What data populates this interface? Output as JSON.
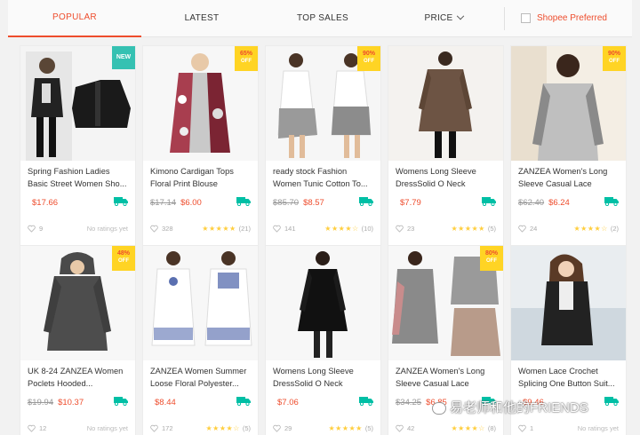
{
  "sortbar": {
    "tabs": [
      "POPULAR",
      "LATEST",
      "TOP SALES",
      "PRICE"
    ],
    "active": "POPULAR",
    "preferred_label": "Shopee Preferred"
  },
  "products": [
    {
      "name": "Spring Fashion Ladies Basic Street Women Sho...",
      "old_price": "",
      "price": "$17.66",
      "likes": "9",
      "rating_count": "",
      "no_rating_text": "No ratings yet",
      "badge": "NEW",
      "stars": 0
    },
    {
      "name": "Kimono Cardigan Tops Floral Print Blouse",
      "old_price": "$17.14",
      "price": "$6.00",
      "likes": "328",
      "rating_count": "(21)",
      "no_rating_text": "",
      "badge_pct": "65%",
      "badge_off": "OFF",
      "stars": 5
    },
    {
      "name": "ready stock Fashion Women Tunic Cotton To...",
      "old_price": "$85.70",
      "price": "$8.57",
      "likes": "141",
      "rating_count": "(10)",
      "no_rating_text": "",
      "badge_pct": "90%",
      "badge_off": "OFF",
      "stars": 4
    },
    {
      "name": "Womens Long Sleeve DressSolid O Neck Casua...",
      "old_price": "",
      "price": "$7.79",
      "likes": "23",
      "rating_count": "(5)",
      "no_rating_text": "",
      "stars": 5
    },
    {
      "name": "ZANZEA Women's Long Sleeve Casual Lace Loos...",
      "old_price": "$62.40",
      "price": "$6.24",
      "likes": "24",
      "rating_count": "(2)",
      "no_rating_text": "",
      "badge_pct": "90%",
      "badge_off": "OFF",
      "stars": 4
    },
    {
      "name": "UK 8-24 ZANZEA Women Poclets Hooded...",
      "old_price": "$19.94",
      "price": "$10.37",
      "likes": "12",
      "rating_count": "",
      "no_rating_text": "No ratings yet",
      "badge_pct": "48%",
      "badge_off": "OFF",
      "stars": 0
    },
    {
      "name": "ZANZEA Women Summer Loose Floral Polyester...",
      "old_price": "",
      "price": "$8.44",
      "likes": "172",
      "rating_count": "(5)",
      "no_rating_text": "",
      "stars": 4
    },
    {
      "name": "Womens Long Sleeve DressSolid O Neck Casua...",
      "old_price": "",
      "price": "$7.06",
      "likes": "29",
      "rating_count": "(5)",
      "no_rating_text": "",
      "stars": 5
    },
    {
      "name": "ZANZEA Women's Long Sleeve Casual Lace Loos...",
      "old_price": "$34.25",
      "price": "$6.85",
      "likes": "42",
      "rating_count": "(8)",
      "no_rating_text": "",
      "badge_pct": "80%",
      "badge_off": "OFF",
      "stars": 4
    },
    {
      "name": "Women Lace Crochet Splicing One Button Suit...",
      "old_price": "",
      "price": "$9.46",
      "likes": "1",
      "rating_count": "",
      "no_rating_text": "No ratings yet",
      "stars": 0
    }
  ],
  "watermark": "易老师和他的FRIENDS",
  "colors": {
    "accent": "#ee4d2d",
    "badge": "#ffd424",
    "new_badge": "#35c1b2",
    "star": "#ffce3d",
    "truck": "#00bfa5"
  }
}
